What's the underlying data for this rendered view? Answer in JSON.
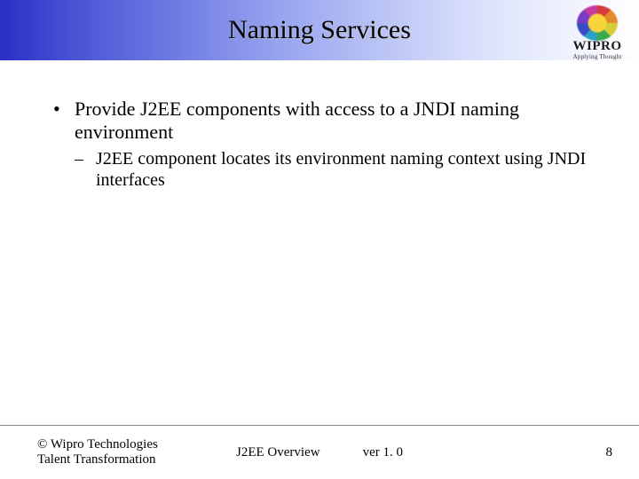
{
  "title": "Naming Services",
  "logo": {
    "word": "WIPRO",
    "tagline": "Applying Thought"
  },
  "bullets": {
    "item1": "Provide J2EE components with access to a JNDI naming environment",
    "sub1": "J2EE component locates its environment naming context using JNDI interfaces"
  },
  "footer": {
    "copyright": "© Wipro Technologies",
    "dept": "Talent Transformation",
    "doc": "J2EE Overview",
    "version": "ver 1. 0",
    "page": "8"
  }
}
